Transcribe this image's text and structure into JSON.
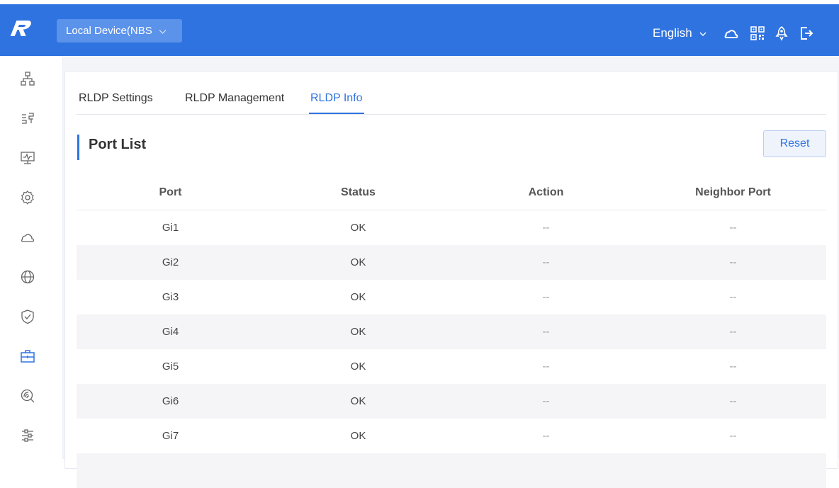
{
  "header": {
    "device_select": "Local Device(NBS",
    "language": "English"
  },
  "tabs": [
    {
      "label": "RLDP Settings"
    },
    {
      "label": "RLDP Management"
    },
    {
      "label": "RLDP Info"
    }
  ],
  "active_tab": "RLDP Info",
  "section": {
    "title": "Port List",
    "reset_label": "Reset"
  },
  "table": {
    "columns": [
      "Port",
      "Status",
      "Action",
      "Neighbor Port"
    ],
    "rows": [
      {
        "port": "Gi1",
        "status": "OK",
        "action": "--",
        "neighbor": "--"
      },
      {
        "port": "Gi2",
        "status": "OK",
        "action": "--",
        "neighbor": "--"
      },
      {
        "port": "Gi3",
        "status": "OK",
        "action": "--",
        "neighbor": "--"
      },
      {
        "port": "Gi4",
        "status": "OK",
        "action": "--",
        "neighbor": "--"
      },
      {
        "port": "Gi5",
        "status": "OK",
        "action": "--",
        "neighbor": "--"
      },
      {
        "port": "Gi6",
        "status": "OK",
        "action": "--",
        "neighbor": "--"
      },
      {
        "port": "Gi7",
        "status": "OK",
        "action": "--",
        "neighbor": "--"
      }
    ]
  },
  "sidebar_icons": [
    "topology-icon",
    "switch-ports-icon",
    "monitor-icon",
    "settings-gear-icon",
    "cloud-icon",
    "globe-icon",
    "shield-check-icon",
    "toolbox-icon",
    "network-diagnose-icon",
    "sliders-icon"
  ],
  "colors": {
    "brand": "#2f73e0",
    "row_alt": "#f5f5f7"
  }
}
